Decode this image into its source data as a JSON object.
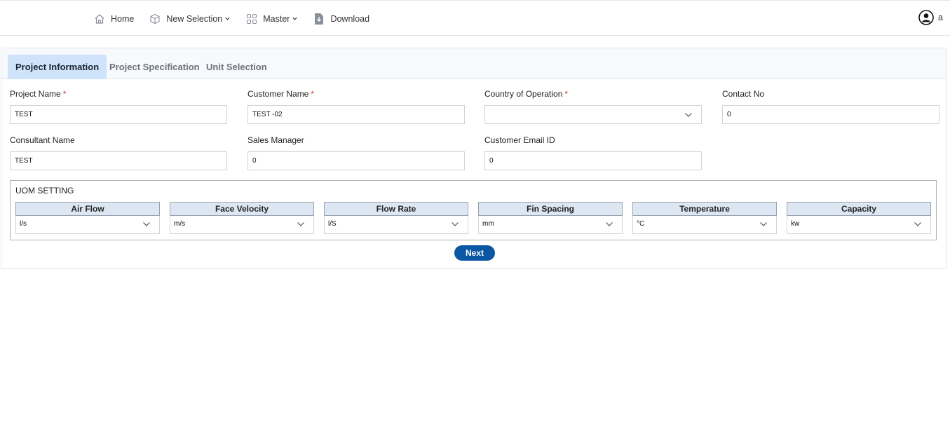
{
  "nav": {
    "home": "Home",
    "new_selection": "New Selection",
    "master": "Master",
    "download": "Download"
  },
  "user": {
    "name": "a"
  },
  "tabs": [
    {
      "label": "Project Information"
    },
    {
      "label": "Project Specification"
    },
    {
      "label": "Unit Selection"
    }
  ],
  "form": {
    "project_name": {
      "label": "Project Name",
      "required": "*",
      "value": "TEST"
    },
    "customer_name": {
      "label": "Customer Name",
      "required": "*",
      "value": "TEST -02"
    },
    "country": {
      "label": "Country of Operation",
      "required": "*",
      "value": ""
    },
    "contact_no": {
      "label": "Contact No",
      "value": "0"
    },
    "consultant_name": {
      "label": "Consultant Name",
      "value": "TEST"
    },
    "sales_manager": {
      "label": "Sales Manager",
      "value": "0"
    },
    "customer_email": {
      "label": "Customer Email ID",
      "value": "0"
    }
  },
  "uom": {
    "title": "UOM SETTING",
    "columns": [
      {
        "header": "Air Flow",
        "value": "l/s"
      },
      {
        "header": "Face Velocity",
        "value": "m/s"
      },
      {
        "header": "Flow Rate",
        "value": "l/S"
      },
      {
        "header": "Fin Spacing",
        "value": "mm"
      },
      {
        "header": "Temperature",
        "value": "°C"
      },
      {
        "header": "Capacity",
        "value": "kw"
      }
    ]
  },
  "next_label": "Next"
}
